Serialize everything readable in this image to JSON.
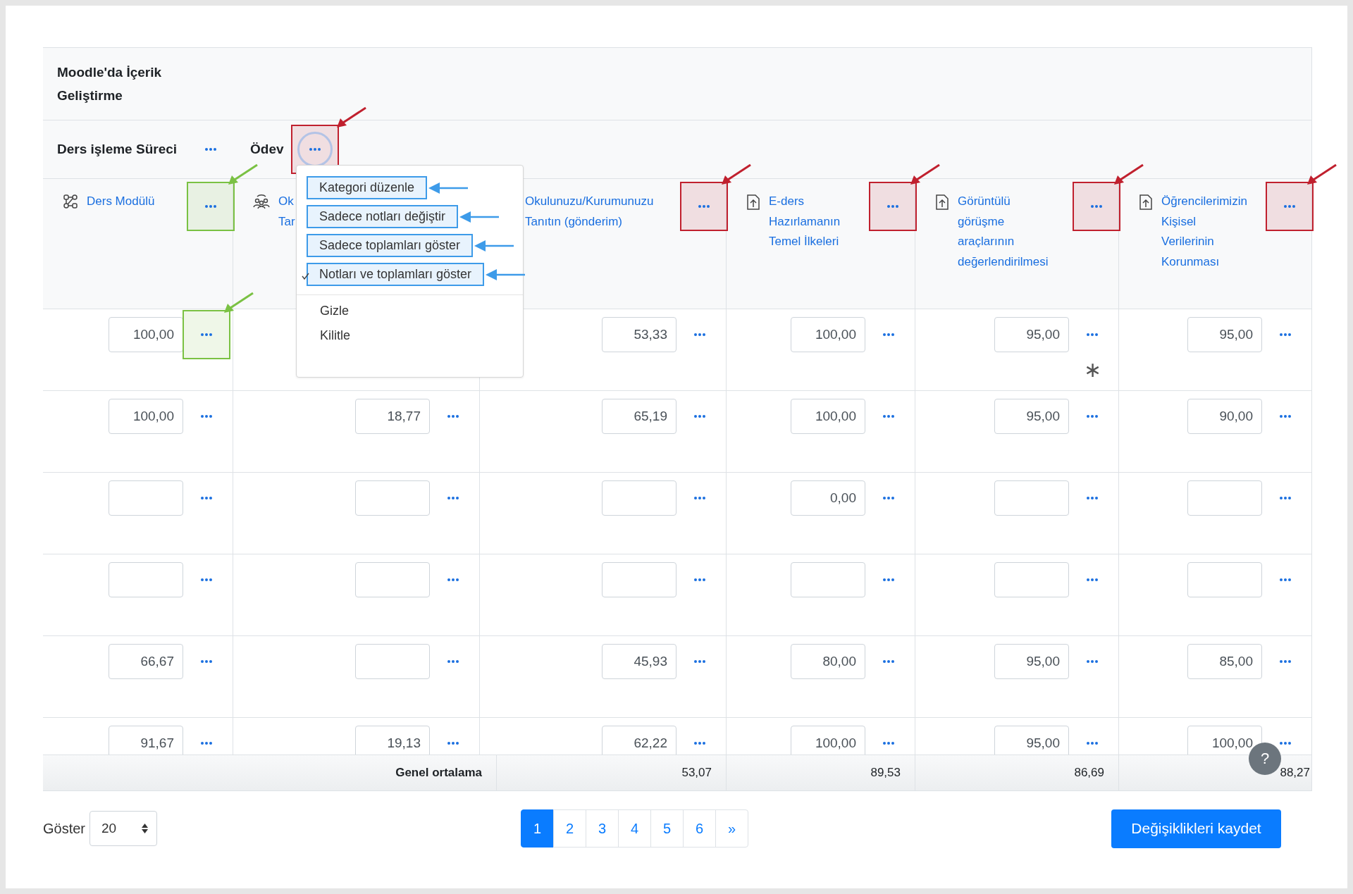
{
  "course": {
    "title": "Moodle'da İçerik Geliştirme"
  },
  "categories": [
    {
      "name": "Ders işleme Süreci",
      "focused": false,
      "annotated": false
    },
    {
      "name": "Ödev",
      "focused": true,
      "annotated": true,
      "color": "#c0202e"
    }
  ],
  "columns": [
    {
      "kind": "category",
      "lines": [
        "Ders Modülü"
      ],
      "menu_button": true,
      "annotated": true,
      "color": "#7ac143"
    },
    {
      "kind": "group",
      "lines": [
        "Ok",
        "Tar"
      ],
      "menu_button": false
    },
    {
      "lines": [
        "Okulunuzu/Kurumunuzu",
        "Tanıtın (gönderim)"
      ],
      "menu_button": true,
      "annotated": true,
      "color": "#c0202e"
    },
    {
      "kind": "assign",
      "lines": [
        "E-ders",
        "Hazırlamanın",
        "Temel İlkeleri"
      ],
      "menu_button": true,
      "annotated": true,
      "color": "#c0202e"
    },
    {
      "kind": "assign",
      "lines": [
        "Görüntülü",
        "görüşme",
        "araçlarının",
        "değerlendirilmesi"
      ],
      "menu_button": true,
      "annotated": true,
      "color": "#c0202e"
    },
    {
      "kind": "assign",
      "lines": [
        "Öğrencilerimizin",
        "Kişisel",
        "Verilerinin",
        "Korunması"
      ],
      "menu_button": true,
      "annotated": true,
      "color": "#c0202e"
    }
  ],
  "rows": [
    {
      "cells": [
        {
          "value": "100,00",
          "annotated": true,
          "color": "#7ac143"
        },
        null,
        {
          "value": "53,33"
        },
        {
          "value": "100,00"
        },
        {
          "value": "95,00",
          "note": "∗"
        },
        {
          "value": "95,00"
        }
      ]
    },
    {
      "cells": [
        {
          "value": "100,00"
        },
        {
          "value": "18,77"
        },
        {
          "value": "65,19"
        },
        {
          "value": "100,00"
        },
        {
          "value": "95,00"
        },
        {
          "value": "90,00"
        }
      ]
    },
    {
      "cells": [
        {},
        {},
        {},
        {
          "value": "0,00"
        },
        {},
        {}
      ]
    },
    {
      "cells": [
        {},
        {},
        {},
        {},
        {},
        {}
      ]
    },
    {
      "cells": [
        {
          "value": "66,67"
        },
        {},
        {
          "value": "45,93"
        },
        {
          "value": "80,00"
        },
        {
          "value": "95,00"
        },
        {
          "value": "85,00"
        }
      ]
    },
    {
      "cells": [
        {
          "value": "91,67"
        },
        {
          "value": "19,13"
        },
        {
          "value": "62,22"
        },
        {
          "value": "100,00"
        },
        {
          "value": "95,00"
        },
        {
          "value": "100,00"
        }
      ]
    }
  ],
  "averages": {
    "label": "Genel ortalama",
    "values": [
      "53,07",
      "89,53",
      "86,69",
      "88,27"
    ]
  },
  "menu": {
    "items": [
      {
        "label": "Kategori düzenle",
        "checked": false,
        "annotated": true
      },
      {
        "label": "Sadece notları değiştir",
        "checked": false,
        "annotated": true
      },
      {
        "label": "Sadece toplamları göster",
        "checked": false,
        "annotated": true
      },
      {
        "label": "Notları ve toplamları göster",
        "checked": true,
        "annotated": true
      },
      {
        "label": "Gizle",
        "checked": false,
        "annotated": false,
        "separator_before": true
      },
      {
        "label": "Kilitle",
        "checked": false,
        "annotated": false
      }
    ]
  },
  "footer": {
    "show_label": "Göster",
    "per_page": "20",
    "pages": [
      {
        "label": "1",
        "selected": true
      },
      {
        "label": "2",
        "selected": false
      },
      {
        "label": "3",
        "selected": false
      },
      {
        "label": "4",
        "selected": false
      },
      {
        "label": "5",
        "selected": false
      },
      {
        "label": "6",
        "selected": false
      },
      {
        "label": "»",
        "selected": false
      }
    ],
    "save_button": "Değişiklikleri kaydet"
  },
  "help_button": "?"
}
